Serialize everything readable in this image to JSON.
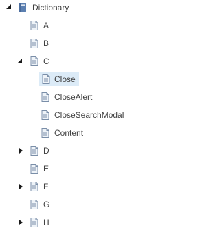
{
  "tree": {
    "root": {
      "label": "Dictionary",
      "icon": "book-icon"
    },
    "items": [
      {
        "label": "A",
        "icon": "document-icon",
        "toggle": "none"
      },
      {
        "label": "B",
        "icon": "document-icon",
        "toggle": "none"
      },
      {
        "label": "C",
        "icon": "document-icon",
        "toggle": "expanded",
        "children": [
          {
            "label": "Close",
            "icon": "document-icon",
            "selected": true
          },
          {
            "label": "CloseAlert",
            "icon": "document-icon"
          },
          {
            "label": "CloseSearchModal",
            "icon": "document-icon"
          },
          {
            "label": "Content",
            "icon": "document-icon"
          }
        ]
      },
      {
        "label": "D",
        "icon": "document-icon",
        "toggle": "collapsed"
      },
      {
        "label": "E",
        "icon": "document-icon",
        "toggle": "none"
      },
      {
        "label": "F",
        "icon": "document-icon",
        "toggle": "collapsed"
      },
      {
        "label": "G",
        "icon": "document-icon",
        "toggle": "none"
      },
      {
        "label": "H",
        "icon": "document-icon",
        "toggle": "collapsed"
      }
    ]
  },
  "colors": {
    "book": "#5b7fb0",
    "doc_fill": "#eef3f8",
    "doc_stroke": "#7a8ea8",
    "selection": "#dcebf7",
    "toggle": "#1a1a1a",
    "text": "#404040"
  }
}
